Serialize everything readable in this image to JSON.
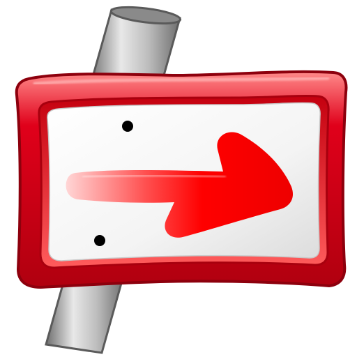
{
  "icon": {
    "semantic": "direction-sign-icon",
    "description_name": "",
    "colors": {
      "frame_red": "#e0001a",
      "frame_dark": "#9b0010",
      "frame_light": "#ff8a8a",
      "panel_white": "#ffffff",
      "panel_shade": "#e6e6e6",
      "arrow_red": "#ff0000",
      "arrow_fade": "#ffd6d6",
      "pole_light": "#e8e8e8",
      "pole_dark": "#6e6e6e",
      "bolt": "#000000"
    }
  }
}
